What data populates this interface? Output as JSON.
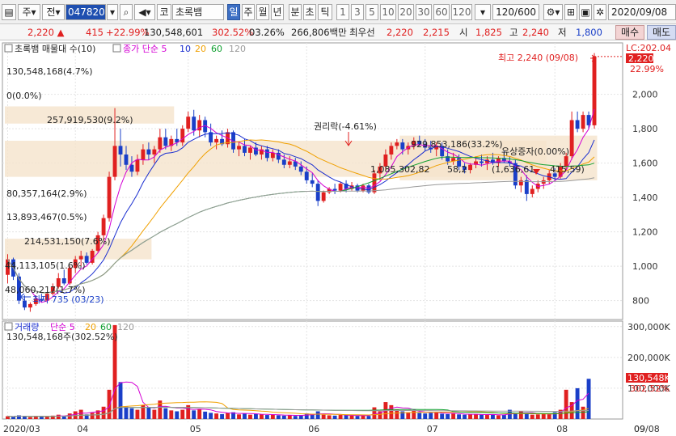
{
  "toolbar": {
    "chart_type_label": "주",
    "market_label": "전",
    "stock_code": "047820",
    "code_prefix": "코",
    "stock_name": "초록뱀",
    "periods": [
      "일",
      "주",
      "월",
      "년",
      "분",
      "초",
      "틱"
    ],
    "active_period": "일",
    "intervals": [
      "1",
      "3",
      "5",
      "10",
      "20",
      "30",
      "60",
      "120"
    ],
    "count_display": "120/600",
    "date": "2020/09/08"
  },
  "quote": {
    "price": "2,220",
    "change": "415",
    "change_pct": "+22.99%",
    "volume": "130,548,601",
    "volume_ratio": "302.52%",
    "turnover": "03.26%",
    "amount": "266,806백만",
    "best_label": "최우선",
    "best_ask": "2,220",
    "best_bid": "2,215",
    "open_label": "시",
    "open": "1,825",
    "high_label": "고",
    "high": "2,240",
    "low_label": "저",
    "low": "1,800",
    "buy_label": "매수",
    "sell_label": "매도"
  },
  "price_panel": {
    "legend_name": "초록뱀 매물대 수(10)",
    "ma_label": "종가 단순",
    "ma_periods": [
      "5",
      "10",
      "20",
      "60",
      "120"
    ],
    "ma_colors": [
      "#d400d4",
      "#1a2ed0",
      "#f0a000",
      "#10a030",
      "#9a9a9a"
    ],
    "lc_label": "LC:202.04",
    "current_price_tag": "2,220",
    "current_pct_tag": "22.99%",
    "high_annotation": "최고 2,240 (09/08)",
    "low_annotation": "최저 735 (03/23)",
    "rights_annotation": "권리락(-4.61%)",
    "capital_annotation": "유상증자(0.00%)",
    "volume_profile_labels": [
      "130,548,168(4.7%)",
      "0(0.0%)",
      "257,919,530(9.2%)",
      "80,357,164(2.9%)",
      "13,893,467(0.5%)",
      "214,531,150(7.6%)",
      "44,113,105(1.6%)",
      "48,060,217(1.7%)",
      "929,853,186(33.2%)",
      "1,085,302,82",
      "58,2",
      "(1,636,61",
      "415,59)"
    ]
  },
  "volume_panel": {
    "legend_name": "거래량",
    "ma_label": "단순",
    "ma_periods": [
      "5",
      "20",
      "60",
      "120"
    ],
    "ma_colors": [
      "#d400d4",
      "#f0a000",
      "#10a030",
      "#9a9a9a"
    ],
    "current_volume_text": "130,548,168주(302.52%)",
    "current_volume_tag": "130,548K",
    "current_pct_tag": "302.52%"
  },
  "chart_data": {
    "type": "candlestick",
    "price_ylim": [
      690,
      2290
    ],
    "price_ticks": [
      "2,000",
      "1,800",
      "1,600",
      "1,400",
      "1,200",
      "1,000",
      "800"
    ],
    "price_tick_values": [
      2000,
      1800,
      1600,
      1400,
      1200,
      1000,
      800
    ],
    "volume_ylim": [
      0,
      310000
    ],
    "volume_ticks": [
      "300,000K",
      "200,000K",
      "100,000K"
    ],
    "volume_tick_values": [
      300000,
      200000,
      100000
    ],
    "x_tick_labels": [
      "2020/03",
      "04",
      "05",
      "06",
      "07",
      "08",
      "09",
      "09/08"
    ],
    "x_tick_index": [
      0,
      12,
      32,
      53,
      74,
      97,
      118,
      130
    ],
    "candles": [
      [
        950,
        1070,
        900,
        1040
      ],
      [
        1040,
        1050,
        920,
        940
      ],
      [
        940,
        960,
        780,
        800
      ],
      [
        800,
        830,
        745,
        760
      ],
      [
        760,
        790,
        735,
        780
      ],
      [
        780,
        830,
        770,
        810
      ],
      [
        810,
        840,
        790,
        800
      ],
      [
        800,
        850,
        790,
        840
      ],
      [
        840,
        900,
        830,
        880
      ],
      [
        880,
        960,
        870,
        930
      ],
      [
        930,
        980,
        890,
        900
      ],
      [
        900,
        1000,
        890,
        990
      ],
      [
        990,
        1060,
        960,
        1040
      ],
      [
        1040,
        1090,
        1000,
        1060
      ],
      [
        1060,
        1080,
        1010,
        1020
      ],
      [
        1020,
        1100,
        1010,
        1090
      ],
      [
        1090,
        1200,
        1080,
        1180
      ],
      [
        1180,
        1300,
        1150,
        1280
      ],
      [
        1280,
        1550,
        1260,
        1520
      ],
      [
        1520,
        1920,
        1500,
        1700
      ],
      [
        1700,
        1800,
        1580,
        1650
      ],
      [
        1650,
        1700,
        1560,
        1590
      ],
      [
        1590,
        1640,
        1520,
        1550
      ],
      [
        1550,
        1650,
        1530,
        1620
      ],
      [
        1620,
        1710,
        1590,
        1680
      ],
      [
        1680,
        1720,
        1620,
        1650
      ],
      [
        1650,
        1700,
        1600,
        1680
      ],
      [
        1680,
        1800,
        1660,
        1750
      ],
      [
        1750,
        1800,
        1680,
        1700
      ],
      [
        1700,
        1760,
        1670,
        1740
      ],
      [
        1740,
        1800,
        1700,
        1720
      ],
      [
        1720,
        1820,
        1700,
        1800
      ],
      [
        1800,
        1900,
        1780,
        1870
      ],
      [
        1870,
        1910,
        1760,
        1790
      ],
      [
        1790,
        1880,
        1750,
        1850
      ],
      [
        1850,
        1870,
        1750,
        1780
      ],
      [
        1780,
        1830,
        1700,
        1720
      ],
      [
        1720,
        1760,
        1680,
        1740
      ],
      [
        1740,
        1790,
        1700,
        1710
      ],
      [
        1710,
        1800,
        1690,
        1780
      ],
      [
        1780,
        1790,
        1660,
        1680
      ],
      [
        1680,
        1720,
        1640,
        1700
      ],
      [
        1700,
        1740,
        1640,
        1660
      ],
      [
        1660,
        1700,
        1620,
        1690
      ],
      [
        1690,
        1720,
        1640,
        1650
      ],
      [
        1650,
        1700,
        1620,
        1680
      ],
      [
        1680,
        1700,
        1610,
        1630
      ],
      [
        1630,
        1680,
        1610,
        1660
      ],
      [
        1660,
        1680,
        1600,
        1620
      ],
      [
        1620,
        1650,
        1570,
        1590
      ],
      [
        1590,
        1640,
        1570,
        1610
      ],
      [
        1610,
        1630,
        1560,
        1580
      ],
      [
        1580,
        1610,
        1530,
        1550
      ],
      [
        1550,
        1580,
        1480,
        1500
      ],
      [
        1500,
        1540,
        1460,
        1480
      ],
      [
        1480,
        1500,
        1350,
        1380
      ],
      [
        1380,
        1440,
        1370,
        1430
      ],
      [
        1430,
        1460,
        1420,
        1450
      ],
      [
        1450,
        1480,
        1420,
        1440
      ],
      [
        1440,
        1490,
        1430,
        1480
      ],
      [
        1480,
        1500,
        1430,
        1450
      ],
      [
        1450,
        1490,
        1440,
        1470
      ],
      [
        1470,
        1480,
        1430,
        1440
      ],
      [
        1440,
        1480,
        1430,
        1470
      ],
      [
        1470,
        1480,
        1420,
        1430
      ],
      [
        1430,
        1560,
        1420,
        1540
      ],
      [
        1540,
        1600,
        1500,
        1580
      ],
      [
        1580,
        1680,
        1560,
        1650
      ],
      [
        1650,
        1720,
        1620,
        1700
      ],
      [
        1700,
        1740,
        1680,
        1720
      ],
      [
        1720,
        1740,
        1650,
        1680
      ],
      [
        1680,
        1720,
        1650,
        1700
      ],
      [
        1700,
        1750,
        1680,
        1730
      ],
      [
        1730,
        1760,
        1700,
        1710
      ],
      [
        1710,
        1740,
        1670,
        1690
      ],
      [
        1690,
        1730,
        1660,
        1680
      ],
      [
        1680,
        1720,
        1640,
        1700
      ],
      [
        1700,
        1720,
        1620,
        1640
      ],
      [
        1640,
        1680,
        1590,
        1610
      ],
      [
        1610,
        1660,
        1590,
        1630
      ],
      [
        1630,
        1650,
        1560,
        1580
      ],
      [
        1580,
        1600,
        1540,
        1560
      ],
      [
        1560,
        1600,
        1540,
        1590
      ],
      [
        1590,
        1640,
        1570,
        1610
      ],
      [
        1610,
        1650,
        1580,
        1600
      ],
      [
        1600,
        1640,
        1560,
        1620
      ],
      [
        1620,
        1660,
        1590,
        1600
      ],
      [
        1600,
        1640,
        1580,
        1630
      ],
      [
        1630,
        1670,
        1600,
        1610
      ],
      [
        1610,
        1640,
        1580,
        1600
      ],
      [
        1600,
        1620,
        1450,
        1470
      ],
      [
        1470,
        1520,
        1430,
        1500
      ],
      [
        1500,
        1530,
        1380,
        1420
      ],
      [
        1420,
        1470,
        1400,
        1450
      ],
      [
        1450,
        1500,
        1430,
        1480
      ],
      [
        1480,
        1520,
        1450,
        1500
      ],
      [
        1500,
        1560,
        1480,
        1540
      ],
      [
        1540,
        1570,
        1500,
        1520
      ],
      [
        1520,
        1600,
        1510,
        1580
      ],
      [
        1580,
        1660,
        1560,
        1640
      ],
      [
        1640,
        1900,
        1620,
        1850
      ],
      [
        1850,
        1900,
        1780,
        1800
      ],
      [
        1800,
        1900,
        1780,
        1880
      ],
      [
        1880,
        1900,
        1800,
        1820
      ],
      [
        1820,
        2240,
        1800,
        2220
      ]
    ],
    "volumes": [
      9000,
      7000,
      12000,
      8000,
      6000,
      10000,
      7000,
      9000,
      11000,
      14000,
      8000,
      18000,
      25000,
      30000,
      15000,
      20000,
      28000,
      40000,
      95000,
      305000,
      120000,
      40000,
      35000,
      30000,
      45000,
      38000,
      30000,
      60000,
      35000,
      28000,
      25000,
      30000,
      45000,
      28000,
      32000,
      24000,
      20000,
      18000,
      16000,
      20000,
      22000,
      15000,
      18000,
      14000,
      16000,
      15000,
      13000,
      14000,
      12000,
      11000,
      12000,
      10000,
      13000,
      18000,
      15000,
      25000,
      14000,
      12000,
      11000,
      13000,
      12000,
      11000,
      10000,
      12000,
      10000,
      38000,
      25000,
      55000,
      45000,
      30000,
      25000,
      22000,
      28000,
      20000,
      18000,
      20000,
      22000,
      17000,
      16000,
      18000,
      15000,
      14000,
      15000,
      16000,
      14000,
      13000,
      15000,
      12000,
      13000,
      30000,
      18000,
      25000,
      16000,
      14000,
      15000,
      18000,
      16000,
      22000,
      30000,
      95000,
      55000,
      100000,
      40000,
      130548
    ],
    "series": [
      {
        "name": "5"
      },
      {
        "name": "10"
      },
      {
        "name": "20"
      },
      {
        "name": "60"
      },
      {
        "name": "120"
      }
    ]
  }
}
